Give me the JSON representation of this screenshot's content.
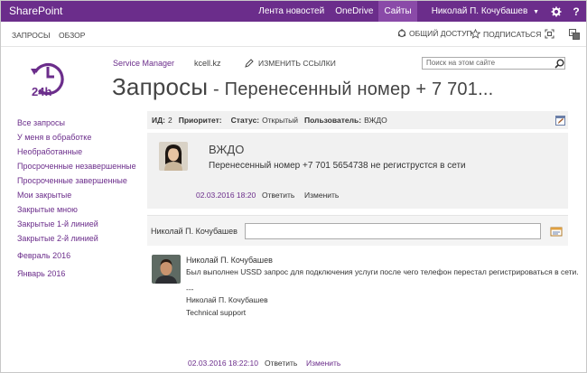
{
  "suite": {
    "brand": "SharePoint",
    "links": [
      "Лента новостей",
      "OneDrive",
      "Сайты"
    ],
    "user": "Николай П. Кочубашев",
    "accent": "#6b2d8b"
  },
  "ribbon": {
    "tabs": [
      "ЗАПРОСЫ",
      "ОБЗОР"
    ],
    "share_label": "ОБЩИЙ ДОСТУП",
    "follow_label": "ПОДПИСАТЬСЯ"
  },
  "header": {
    "nav_links": [
      "Service Manager",
      "kcell.kz"
    ],
    "edit_links_label": "ИЗМЕНИТЬ ССЫЛКИ",
    "search_placeholder": "Поиск на этом сайте",
    "title": "Запросы",
    "title_sep": " - ",
    "title_sub": "Перенесенный номер + 7 701..."
  },
  "leftnav": {
    "items": [
      "Все запросы",
      "У меня в обработке",
      "Необработанные",
      "Просроченные незавершенные",
      "Просроченные завершенные",
      "Мои закрытые",
      "Закрытые мною",
      "Закрытые 1-й линией",
      "Закрытые 2-й линией",
      "Февраль 2016",
      "Январь 2016"
    ]
  },
  "details": {
    "id_label": "ИД:",
    "id_value": "2",
    "priority_label": "Приоритет:",
    "priority_value": "",
    "status_label": "Статус:",
    "status_value": "Открытый",
    "user_label": "Пользователь:",
    "user_value": "ВЖДО"
  },
  "post": {
    "author": "ВЖДО",
    "text": "Перенесенный номер +7 701 5654738 не региструстся в сети",
    "date": "02.03.2016 18:20",
    "reply_label": "Ответить",
    "edit_label": "Изменить"
  },
  "reply_box": {
    "name": "Николай П. Кочубашев"
  },
  "comment": {
    "author": "Николай П. Кочубашев",
    "text": "Был выполнен USSD запрос для подключения услуги после чего телефон перестал регистрироваться в сети.",
    "sig_sep": "---",
    "sig_name": "Николай П. Кочубашев",
    "sig_role": "Technical support",
    "date": "02.03.2016 18:22:10",
    "reply_label": "Ответить",
    "edit_label": "Изменить"
  }
}
